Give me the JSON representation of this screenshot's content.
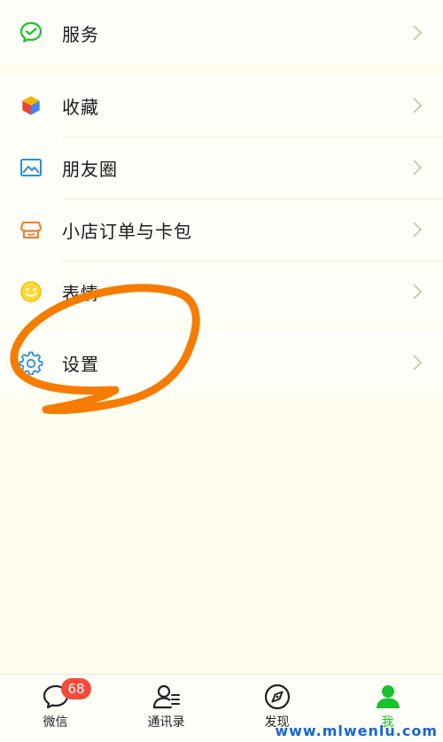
{
  "menu": {
    "service": {
      "label": "服务",
      "icon": "wechat-pay-icon"
    },
    "favorites": {
      "label": "收藏",
      "icon": "cube-icon"
    },
    "moments": {
      "label": "朋友圈",
      "icon": "photo-icon"
    },
    "shop_orders": {
      "label": "小店订单与卡包",
      "icon": "shop-icon"
    },
    "stickers": {
      "label": "表情",
      "icon": "smiley-icon"
    },
    "settings": {
      "label": "设置",
      "icon": "gear-icon"
    }
  },
  "tabbar": {
    "tabs": [
      {
        "label": "微信",
        "icon": "chat-bubble-icon",
        "badge": "68"
      },
      {
        "label": "通讯录",
        "icon": "contacts-icon"
      },
      {
        "label": "发现",
        "icon": "compass-icon"
      },
      {
        "label": "我",
        "icon": "person-icon",
        "active": true
      }
    ]
  },
  "watermark": "www.mlwenlu.com",
  "colors": {
    "background": "#fffdf0",
    "row_background": "#fffef8",
    "active_tab": "#1ac22c",
    "badge": "#f44a3a",
    "annotation_stroke": "#f57c00",
    "watermark": "#1565d6"
  }
}
